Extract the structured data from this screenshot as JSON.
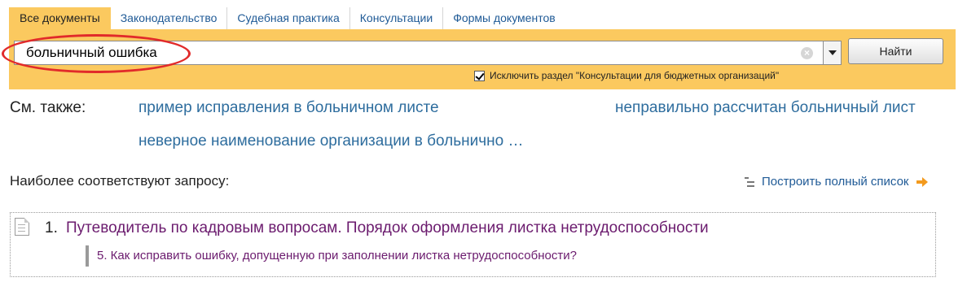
{
  "tabs": [
    {
      "label": "Все документы",
      "active": true
    },
    {
      "label": "Законодательство",
      "active": false
    },
    {
      "label": "Судебная практика",
      "active": false
    },
    {
      "label": "Консультации",
      "active": false
    },
    {
      "label": "Формы документов",
      "active": false
    }
  ],
  "search": {
    "value": "больничный ошибка",
    "clear_icon": "clear-icon",
    "dropdown_icon": "chevron-down-icon",
    "button_label": "Найти",
    "exclude_checked": true,
    "exclude_label": "Исключить раздел \"Консультации для бюджетных организаций\""
  },
  "see_also": {
    "label": "См. также:",
    "links": [
      "пример исправления в больничном листе",
      "неправильно рассчитан больничный лист",
      "неверное наименование организации в больнично …"
    ]
  },
  "results": {
    "heading": "Наиболее соответствуют запросу:",
    "full_list_label": "Построить полный список",
    "items": [
      {
        "number": "1.",
        "title": "Путеводитель по кадровым вопросам. Порядок оформления листка нетрудоспособности",
        "sub": "5. Как исправить ошибку, допущенную при заполнении листка нетрудоспособности?"
      }
    ]
  },
  "colors": {
    "panel": "#fbc95f",
    "link": "#2e6d9e",
    "visited": "#6b1b6e",
    "highlight": "#e12a2a"
  }
}
